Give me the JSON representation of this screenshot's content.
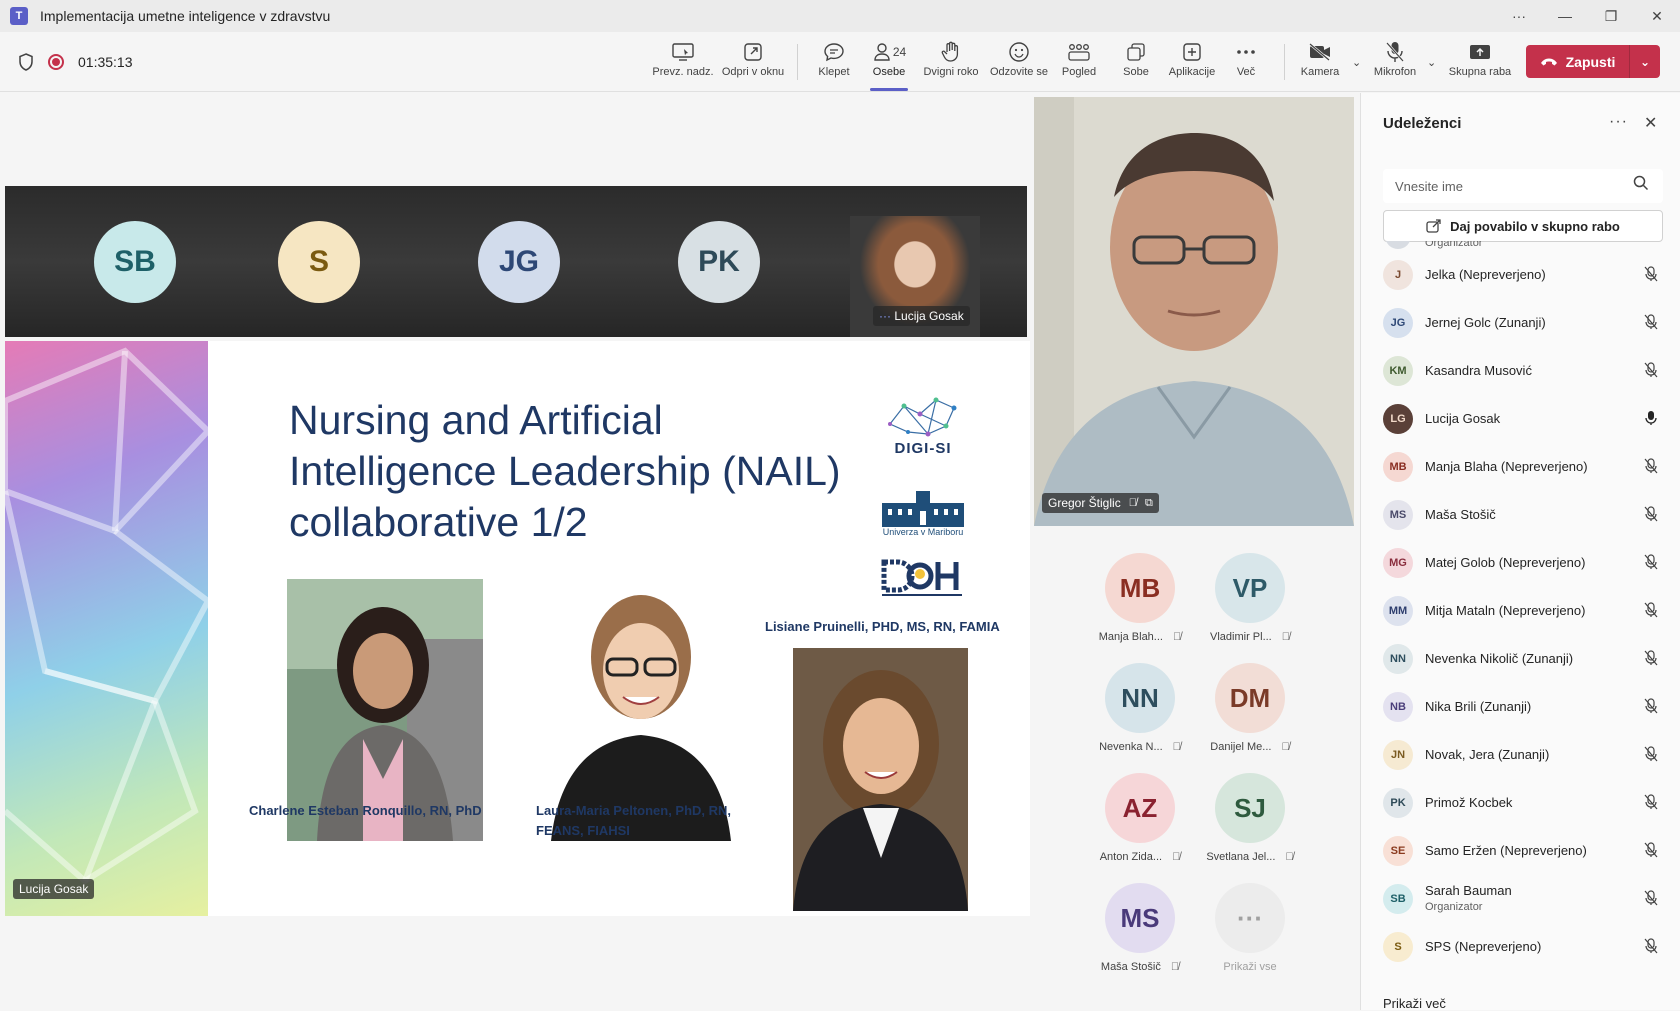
{
  "window": {
    "title": "Implementacija umetne inteligence v zdravstvu",
    "controls": [
      "···",
      "—",
      "❐",
      "✕"
    ]
  },
  "toolbar": {
    "timer": "01:35:13",
    "buttons": [
      {
        "label": "Prevz. nadz.",
        "icon": "screen-control-icon"
      },
      {
        "label": "Odpri v oknu",
        "icon": "pop-out-icon"
      },
      {
        "label": "Klepet",
        "icon": "chat-icon"
      },
      {
        "label": "Osebe",
        "icon": "people-icon",
        "count": "24"
      },
      {
        "label": "Dvigni roko",
        "icon": "raise-hand-icon"
      },
      {
        "label": "Odzovite se",
        "icon": "react-icon"
      },
      {
        "label": "Pogled",
        "icon": "view-icon"
      },
      {
        "label": "Sobe",
        "icon": "rooms-icon"
      },
      {
        "label": "Aplikacije",
        "icon": "apps-icon"
      },
      {
        "label": "Več",
        "icon": "more-icon"
      },
      {
        "label": "Kamera",
        "icon": "camera-off-icon"
      },
      {
        "label": "Mikrofon",
        "icon": "mic-off-icon"
      },
      {
        "label": "Skupna raba",
        "icon": "share-icon"
      }
    ],
    "leave_label": "Zapusti",
    "accent": "#5b5fc7",
    "leave_color": "#c4314b"
  },
  "strip": {
    "avatars": [
      {
        "initials": "SB",
        "bg": "#c8e9ea",
        "fg": "#1e6068"
      },
      {
        "initials": "S",
        "bg": "#f6e6c2",
        "fg": "#7a5a10"
      },
      {
        "initials": "JG",
        "bg": "#d2dcec",
        "fg": "#2e4876"
      },
      {
        "initials": "PK",
        "bg": "#d8e0e4",
        "fg": "#2e4a58"
      }
    ],
    "speaker_name": "Lucija Gosak"
  },
  "slide": {
    "title": "Nursing and Artificial Intelligence Leadership (NAIL) collaborative 1/2",
    "logo_digisi": "DIGI-SI",
    "logo_um": "Univerza v Mariboru",
    "person1": "Charlene Esteban Ronquillo, RN, PhD",
    "person2_line1": "Laura-Maria Peltonen, PhD, RN,",
    "person2_line2": "FEANS, FIAHSI",
    "person3": "Lisiane Pruinelli, PHD, MS, RN, FAMIA",
    "presenter_tag": "Lucija Gosak"
  },
  "main_video": {
    "name": "Gregor Štiglic"
  },
  "grid": [
    {
      "initials": "MB",
      "name": "Manja Blah...",
      "bg": "#f5d8d2",
      "fg": "#8a2e22"
    },
    {
      "initials": "VP",
      "name": "Vladimir Pl...",
      "bg": "#d8e6ea",
      "fg": "#2e5a68"
    },
    {
      "initials": "NN",
      "name": "Nevenka N...",
      "bg": "#d6e4ea",
      "fg": "#2e4e5e"
    },
    {
      "initials": "DM",
      "name": "Danijel Me...",
      "bg": "#f2ddd6",
      "fg": "#7a3a28"
    },
    {
      "initials": "AZ",
      "name": "Anton Zida...",
      "bg": "#f6d6d8",
      "fg": "#8a2230"
    },
    {
      "initials": "SJ",
      "name": "Svetlana Jel...",
      "bg": "#d6e6dc",
      "fg": "#2e5a3e"
    },
    {
      "initials": "MS",
      "name": "Maša Stošič",
      "bg": "#e2dcf0",
      "fg": "#4a3a7a"
    },
    {
      "initials": "···",
      "name": "Prikaži vse",
      "bg": "#ececec",
      "fg": "#a0a0a0"
    }
  ],
  "panel": {
    "title": "Udeleženci",
    "search_placeholder": "Vnesite ime",
    "share_label": "Daj povabilo v skupno rabo",
    "partial_label": "Organizator",
    "participants": [
      {
        "initials": "J",
        "name": "Jelka (Nepreverjeno)",
        "sub": "",
        "bg": "#f0e4de",
        "fg": "#7a4a30",
        "mic": "off"
      },
      {
        "initials": "JG",
        "name": "Jernej Golc (Zunanji)",
        "sub": "",
        "bg": "#d6e0ee",
        "fg": "#2e4876",
        "mic": "off"
      },
      {
        "initials": "KM",
        "name": "Kasandra Musović",
        "sub": "",
        "bg": "#dde6d6",
        "fg": "#3e5a2e",
        "mic": "off"
      },
      {
        "initials": "LG",
        "name": "Lucija Gosak",
        "sub": "",
        "bg": "#5a4038",
        "fg": "#f0d8c8",
        "mic": "on"
      },
      {
        "initials": "MB",
        "name": "Manja Blaha (Nepreverjeno)",
        "sub": "",
        "bg": "#f5d8d2",
        "fg": "#8a2e22",
        "mic": "off"
      },
      {
        "initials": "MS",
        "name": "Maša Stošič",
        "sub": "",
        "bg": "#e4e4ec",
        "fg": "#4a4a6a",
        "mic": "off"
      },
      {
        "initials": "MG",
        "name": "Matej Golob (Nepreverjeno)",
        "sub": "",
        "bg": "#f4d8dc",
        "fg": "#8a2e3e",
        "mic": "off"
      },
      {
        "initials": "MM",
        "name": "Mitja Mataln (Nepreverjeno)",
        "sub": "",
        "bg": "#dde2ee",
        "fg": "#2e3e6e",
        "mic": "off"
      },
      {
        "initials": "NN",
        "name": "Nevenka Nikolič (Zunanji)",
        "sub": "",
        "bg": "#e0e8ea",
        "fg": "#2e4e5e",
        "mic": "off"
      },
      {
        "initials": "NB",
        "name": "Nika Brili (Zunanji)",
        "sub": "",
        "bg": "#e4e2f0",
        "fg": "#4a3e7a",
        "mic": "off"
      },
      {
        "initials": "JN",
        "name": "Novak, Jera (Zunanji)",
        "sub": "",
        "bg": "#f6ead2",
        "fg": "#7a5a20",
        "mic": "off"
      },
      {
        "initials": "PK",
        "name": "Primož Kocbek",
        "sub": "",
        "bg": "#e0e6ea",
        "fg": "#2e4a58",
        "mic": "off"
      },
      {
        "initials": "SE",
        "name": "Samo Eržen (Nepreverjeno)",
        "sub": "",
        "bg": "#f8e0d6",
        "fg": "#8a3a1e",
        "mic": "off"
      },
      {
        "initials": "SB",
        "name": "Sarah Bauman",
        "sub": "Organizator",
        "bg": "#d4ecee",
        "fg": "#1e6068",
        "mic": "off"
      },
      {
        "initials": "S",
        "name": "SPS (Nepreverjeno)",
        "sub": "",
        "bg": "#f8ecd0",
        "fg": "#7a5a10",
        "mic": "off"
      }
    ],
    "show_more": "Prikaži več"
  }
}
